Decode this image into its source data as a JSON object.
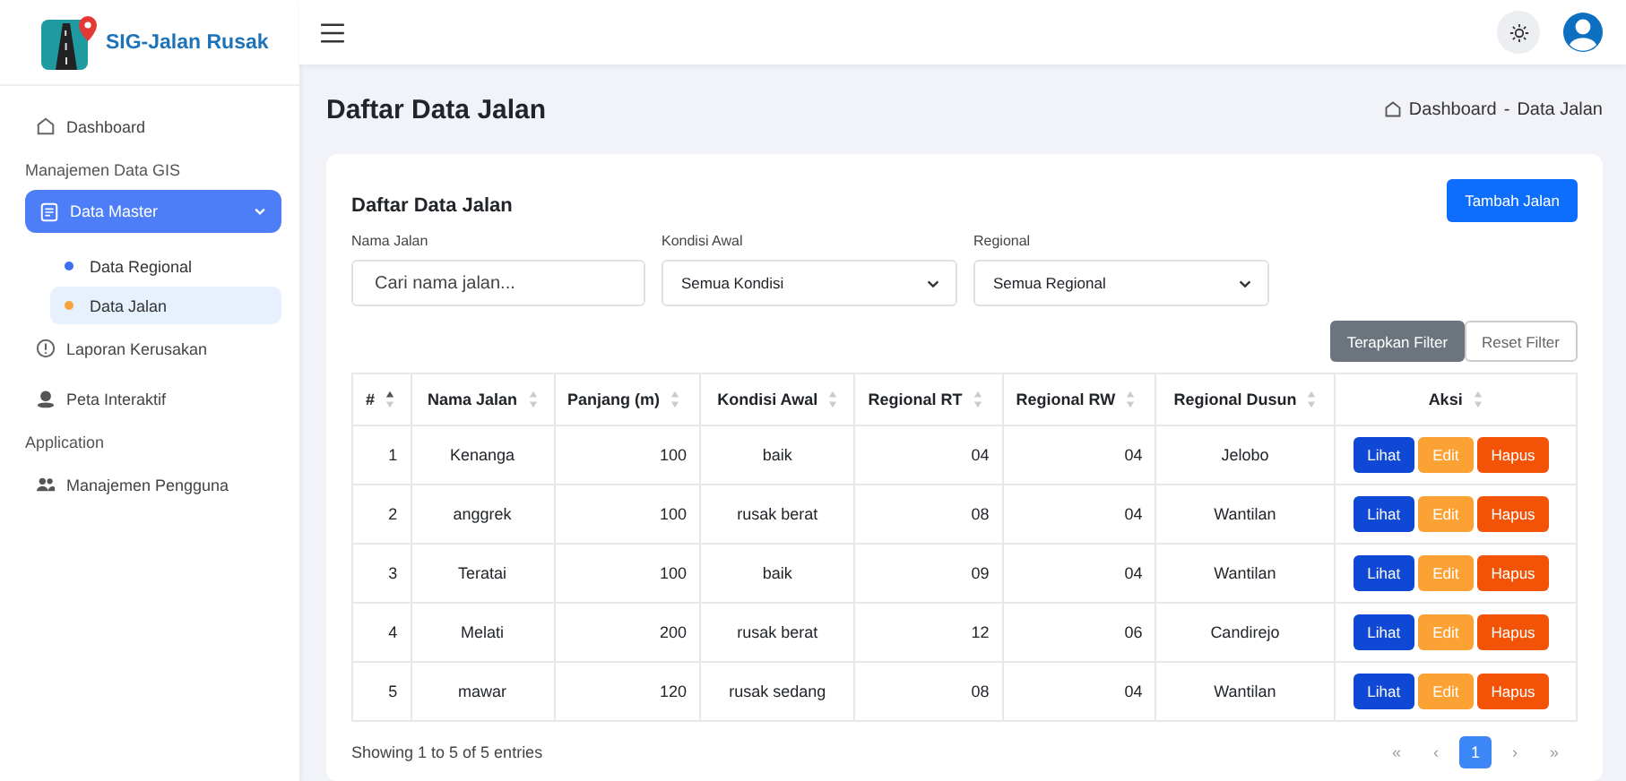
{
  "brand": {
    "name": "SIG-Jalan Rusak"
  },
  "sidebar": {
    "items": [
      {
        "kind": "link",
        "label": "Dashboard",
        "selected": false
      },
      {
        "kind": "section",
        "label": "Manajemen Data GIS"
      },
      {
        "kind": "group",
        "label": "Data Master",
        "expanded": true,
        "selected": true,
        "children": [
          {
            "label": "Data Regional",
            "selected": false
          },
          {
            "label": "Data Jalan",
            "selected": true
          }
        ]
      },
      {
        "kind": "link",
        "label": "Laporan Kerusakan",
        "selected": false
      },
      {
        "kind": "link",
        "label": "Peta Interaktif",
        "selected": false
      },
      {
        "kind": "section",
        "label": "Application"
      },
      {
        "kind": "link",
        "label": "Manajemen Pengguna",
        "selected": false
      }
    ]
  },
  "page": {
    "title": "Daftar Data Jalan",
    "breadcrumb": [
      "Dashboard",
      "-",
      "Data Jalan"
    ]
  },
  "card": {
    "title": "Daftar Data Jalan",
    "add_button": "Tambah Jalan",
    "filters": [
      {
        "label": "Nama Jalan",
        "kind": "text",
        "placeholder": "Cari nama jalan..."
      },
      {
        "label": "Kondisi Awal",
        "kind": "select",
        "value": "Semua Kondisi"
      },
      {
        "label": "Regional",
        "kind": "select",
        "value": "Semua Regional"
      }
    ],
    "apply_button": "Terapkan Filter",
    "reset_button": "Reset Filter"
  },
  "table": {
    "columns": [
      {
        "label": "#",
        "sorted_ascending": true
      },
      {
        "label": "Nama Jalan",
        "sorted_ascending": false
      },
      {
        "label": "Panjang (m)",
        "sorted_ascending": false
      },
      {
        "label": "Kondisi Awal",
        "sorted_ascending": false
      },
      {
        "label": "Regional RT",
        "sorted_ascending": false
      },
      {
        "label": "Regional RW",
        "sorted_ascending": false
      },
      {
        "label": "Regional Dusun",
        "sorted_ascending": false
      },
      {
        "label": "Aksi",
        "sorted_ascending": false
      }
    ],
    "rows": [
      {
        "cells": [
          "1",
          "Kenanga",
          "100",
          "baik",
          "04",
          "04",
          "Jelobo"
        ],
        "actions": [
          "Lihat",
          "Edit",
          "Hapus"
        ]
      },
      {
        "cells": [
          "2",
          "anggrek",
          "100",
          "rusak berat",
          "08",
          "04",
          "Wantilan"
        ],
        "actions": [
          "Lihat",
          "Edit",
          "Hapus"
        ]
      },
      {
        "cells": [
          "3",
          "Teratai",
          "100",
          "baik",
          "09",
          "04",
          "Wantilan"
        ],
        "actions": [
          "Lihat",
          "Edit",
          "Hapus"
        ]
      },
      {
        "cells": [
          "4",
          "Melati",
          "200",
          "rusak berat",
          "12",
          "06",
          "Candirejo"
        ],
        "actions": [
          "Lihat",
          "Edit",
          "Hapus"
        ]
      },
      {
        "cells": [
          "5",
          "mawar",
          "120",
          "rusak sedang",
          "08",
          "04",
          "Wantilan"
        ],
        "actions": [
          "Lihat",
          "Edit",
          "Hapus"
        ]
      }
    ]
  },
  "footer": {
    "info": "Showing 1 to 5 of 5 entries",
    "pagination": [
      {
        "label": "«",
        "selected": false
      },
      {
        "label": "‹",
        "selected": false
      },
      {
        "label": "1",
        "selected": true
      },
      {
        "label": "›",
        "selected": false
      },
      {
        "label": "»",
        "selected": false
      }
    ]
  }
}
